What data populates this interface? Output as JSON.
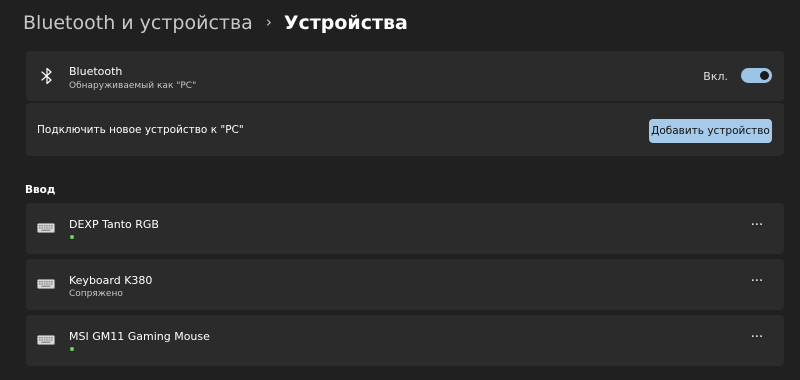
{
  "breadcrumb": {
    "parent": "Bluetooth и устройства",
    "separator": "›",
    "current": "Устройства"
  },
  "bluetooth": {
    "icon": "bluetooth-icon",
    "title": "Bluetooth",
    "subtitle": "Обнаруживаемый как \"PC\"",
    "toggle_label": "Вкл.",
    "toggle_on": true
  },
  "add_device": {
    "text": "Подключить новое устройство к \"PC\"",
    "button_label": "Добавить устройство"
  },
  "section": {
    "title": "Ввод"
  },
  "devices": [
    {
      "name": "DEXP Tanto RGB",
      "status": "",
      "icon": "keyboard-icon",
      "connected_dot": true
    },
    {
      "name": "Keyboard K380",
      "status": "Сопряжено",
      "icon": "keyboard-icon",
      "connected_dot": false
    },
    {
      "name": "MSI GM11 Gaming Mouse",
      "status": "",
      "icon": "keyboard-icon",
      "connected_dot": true
    }
  ],
  "more_label": "···",
  "colors": {
    "background": "#202020",
    "card": "#2b2b2b",
    "accent": "#a6cbea",
    "status_green": "#6ccb5f"
  }
}
